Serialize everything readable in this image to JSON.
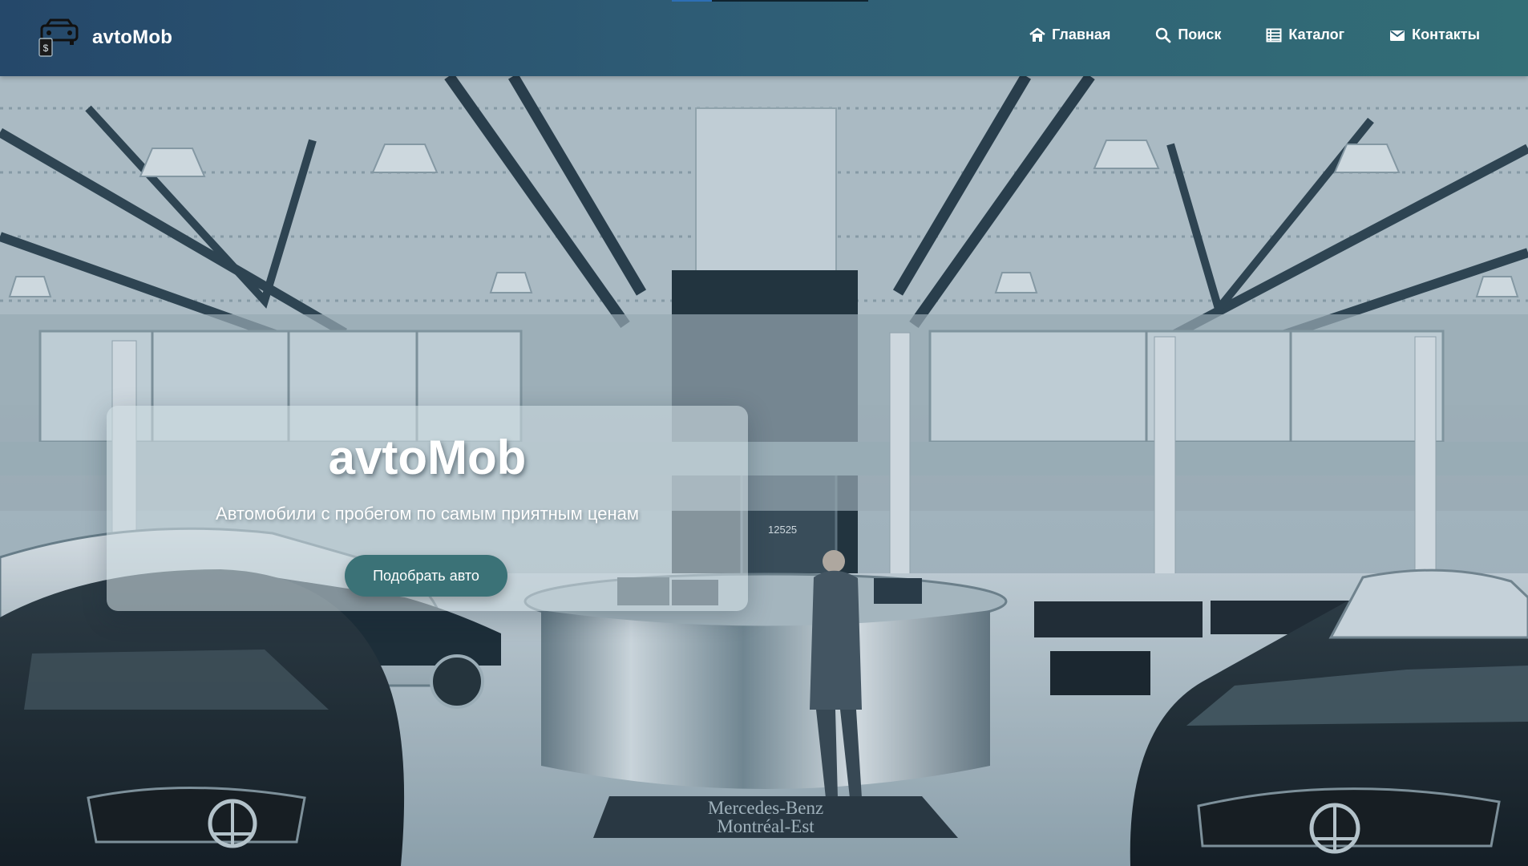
{
  "navbar": {
    "brand_name": "avtoMob",
    "logo_icon": "car-dealer-icon",
    "items": [
      {
        "label": "Главная",
        "icon": "home-icon"
      },
      {
        "label": "Поиск",
        "icon": "search-icon"
      },
      {
        "label": "Каталог",
        "icon": "catalog-icon"
      },
      {
        "label": "Контакты",
        "icon": "envelope-icon"
      }
    ]
  },
  "hero": {
    "title": "avtoMob",
    "subtitle": "Автомобили с пробегом по самым приятным ценам",
    "button_label": "Подобрать авто",
    "background_image": "car-showroom-photo",
    "sign_text": [
      "Mercedes-Benz",
      "Montréal-Est"
    ],
    "door_number": "12525"
  },
  "colors": {
    "navbar_start": "#25486a",
    "navbar_end": "#326e76",
    "button": "#3b7277",
    "text": "#ffffff"
  }
}
